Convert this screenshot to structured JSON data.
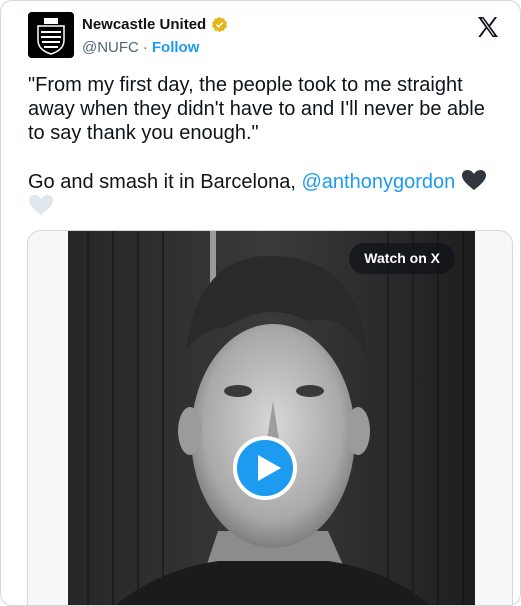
{
  "account": {
    "name": "Newcastle United",
    "handle": "@NUFC",
    "separator": "·",
    "follow_label": "Follow",
    "verified_badge_color": "#e2b719",
    "avatar_icon": "nufc-crest-icon"
  },
  "tweet": {
    "quote": "\"From my first day, the people took to me straight away when they didn't have to and I'll never be able to say thank you enough.\"",
    "line2_prefix": "Go and smash it in Barcelona, ",
    "mention": "@anthonygordon",
    "hearts": [
      "black-heart-icon",
      "white-heart-icon"
    ]
  },
  "media": {
    "watch_label": "Watch on X",
    "play_icon": "play-icon"
  },
  "brand": {
    "logo": "x-logo-icon",
    "accent": "#1d9bf0"
  }
}
